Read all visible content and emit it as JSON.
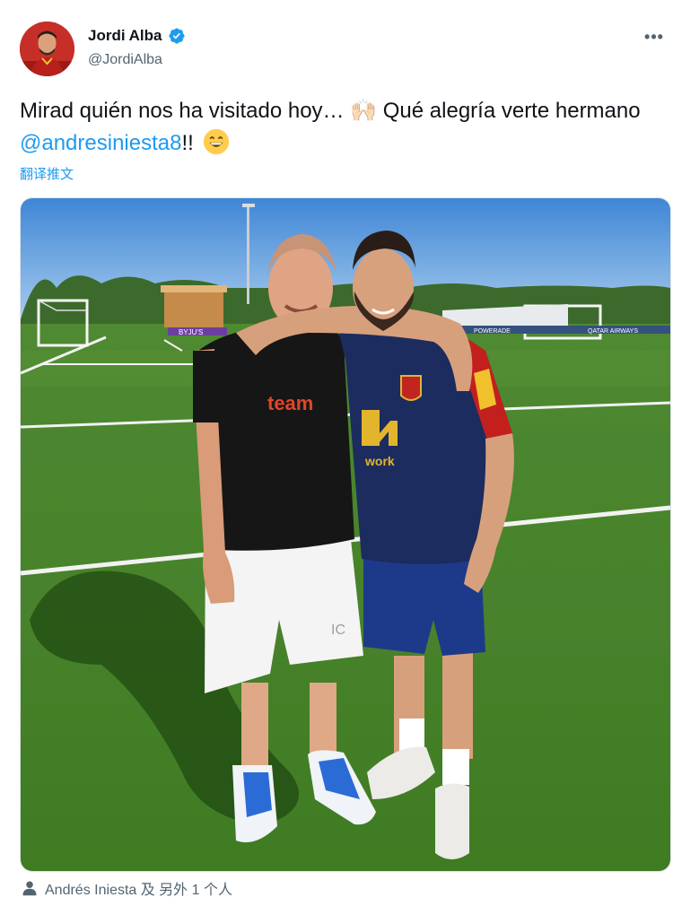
{
  "author": {
    "display_name": "Jordi Alba",
    "handle": "@JordiAlba",
    "verified": true
  },
  "tweet": {
    "text_part1": "Mirad quién nos ha visitado hoy… ",
    "emoji1": "🙌🏻",
    "text_part2": " Qué alegría verte hermano ",
    "mention": "@andresiniesta8",
    "text_part3": "!!",
    "emoji2": "grinning-face",
    "translate_link": "翻译推文"
  },
  "photo": {
    "shirt_text_left": "team",
    "shirt_text_right": "work",
    "shorts_text": "IC",
    "board_text": "BYJU'S",
    "banner_text_1": "POWERADE",
    "banner_text_2": "QATAR AIRWAYS"
  },
  "tags": {
    "label": "Andrés Iniesta 及 另外 1 个人"
  },
  "colors": {
    "accent": "#1d9bf0",
    "secondary_text": "#536471",
    "primary_text": "#0f1419"
  }
}
